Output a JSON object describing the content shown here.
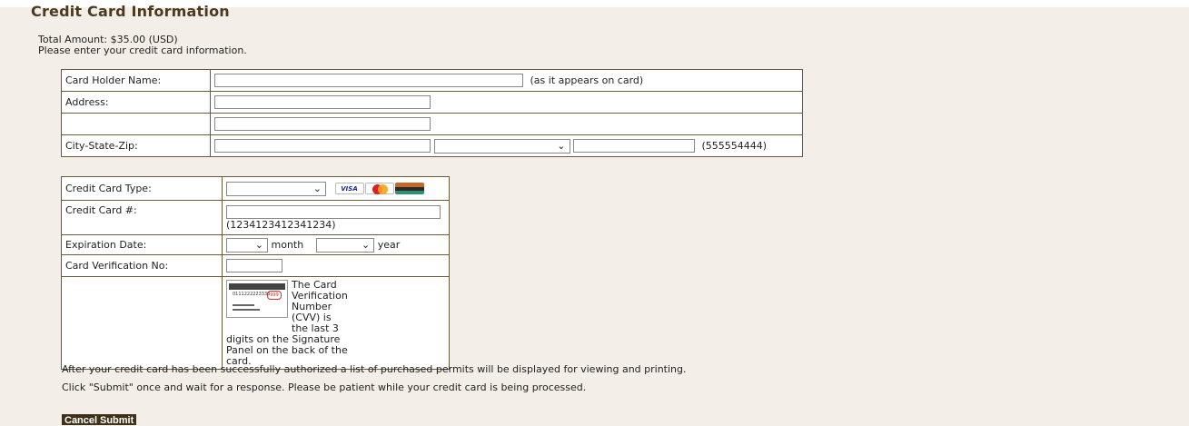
{
  "page": {
    "title": "Credit Card Information",
    "total_amount": "Total Amount:  $35.00 (USD)",
    "instruction": "Please enter your credit card information."
  },
  "address_form": {
    "cardholder_label": "Card Holder Name:",
    "cardholder_hint": "(as it appears on card)",
    "address_label": "Address:",
    "city_state_zip_label": "City-State-Zip:",
    "zip_hint": "(555554444)"
  },
  "card_form": {
    "card_type_label": "Credit Card Type:",
    "card_logos": [
      "VISA",
      "MasterCard",
      "Discover"
    ],
    "card_number_label": "Credit Card #:",
    "card_number_hint": "(1234123412341234)",
    "expiration_label": "Expiration Date:",
    "month_label": "month",
    "year_label": "year",
    "cvv_label": "Card Verification No:",
    "cvv_card_number": "0111222223333",
    "cvv_code": "999",
    "cvv_text_1": "The Card Verification Number (CVV) is the last 3",
    "cvv_text_2": "digits on the Signature Panel on the back of the card."
  },
  "notes": {
    "line1": "After your credit card has been successfully authorized a list of purchased permits will be displayed for viewing and printing.",
    "line2": "Click \"Submit\" once and wait for a response. Please be patient while your credit card is being processed."
  },
  "buttons": {
    "cancel": "Cancel",
    "submit": "Submit"
  },
  "colors": {
    "background": "#f3efe8",
    "border": "#6b5a3c",
    "title": "#4a3a20",
    "button": "#3f3019"
  }
}
